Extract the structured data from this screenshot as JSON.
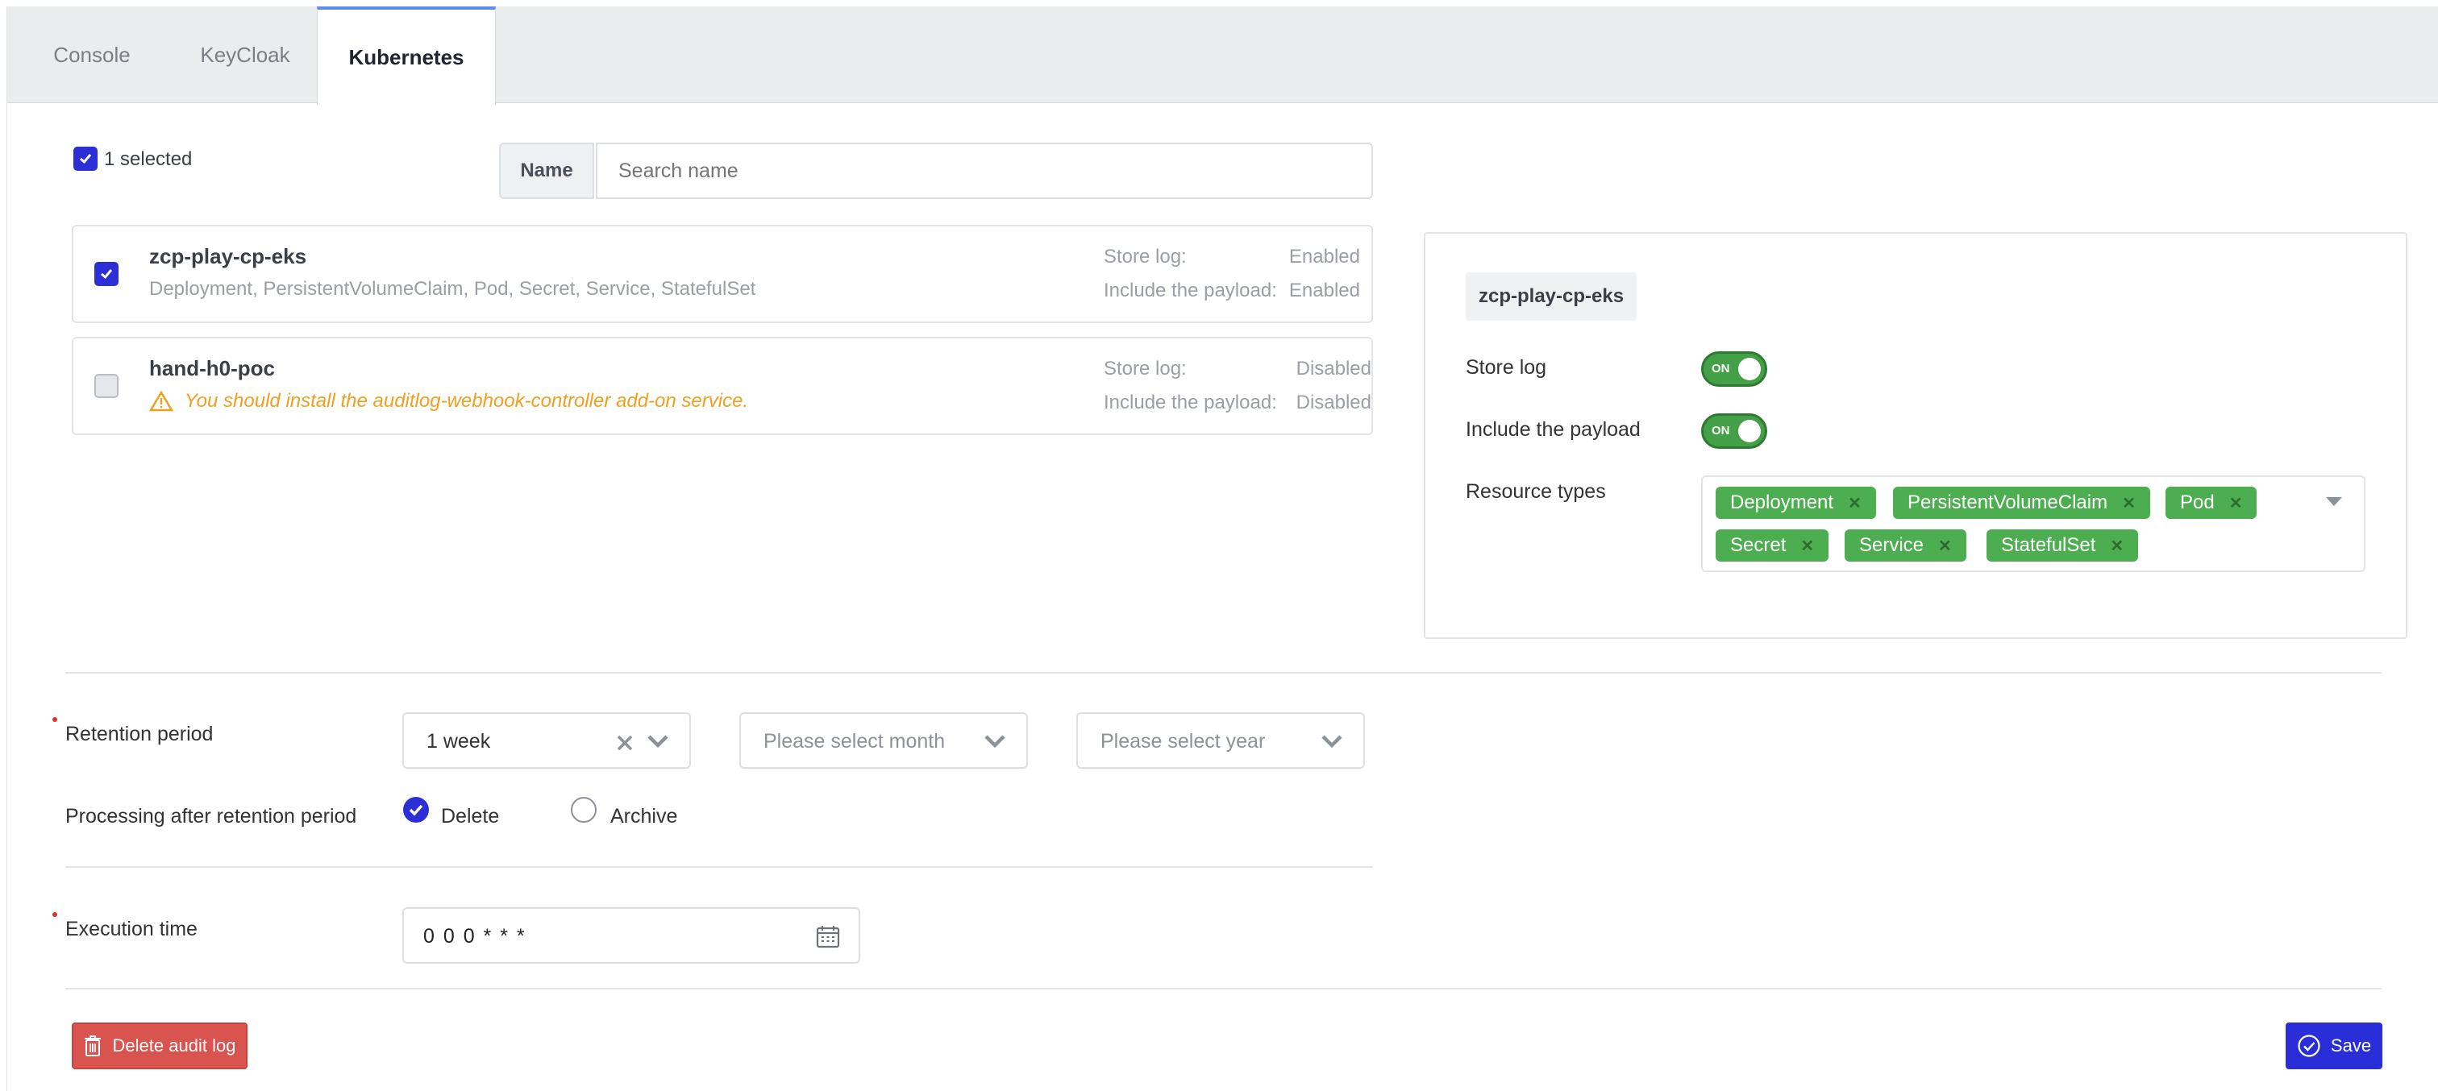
{
  "tabs": [
    {
      "label": "Console"
    },
    {
      "label": "KeyCloak"
    },
    {
      "label": "Kubernetes"
    }
  ],
  "selection": {
    "count_label": "1 selected"
  },
  "search": {
    "label": "Name",
    "placeholder": "Search name"
  },
  "clusters": [
    {
      "name": "zcp-play-cp-eks",
      "resources": "Deployment, PersistentVolumeClaim, Pod, Secret, Service, StatefulSet",
      "store_log_key": "Store log:",
      "store_log_value": "Enabled",
      "payload_key": "Include the payload:",
      "payload_value": "Enabled"
    },
    {
      "name": "hand-h0-poc",
      "warning": "You should install the auditlog-webhook-controller add-on service.",
      "store_log_key": "Store log:",
      "store_log_value": "Disabled",
      "payload_key": "Include the payload:",
      "payload_value": "Disabled"
    }
  ],
  "detail": {
    "title": "zcp-play-cp-eks",
    "store_log_label": "Store log",
    "store_log_state": "ON",
    "payload_label": "Include the payload",
    "payload_state": "ON",
    "resource_types_label": "Resource types",
    "resource_types": [
      "Deployment",
      "PersistentVolumeClaim",
      "Pod",
      "Secret",
      "Service",
      "StatefulSet"
    ]
  },
  "retention": {
    "label": "Retention period",
    "week_value": "1 week",
    "month_placeholder": "Please select month",
    "year_placeholder": "Please select year"
  },
  "processing": {
    "label": "Processing after retention period",
    "options": [
      "Delete",
      "Archive"
    ],
    "selected": "Delete"
  },
  "execution": {
    "label": "Execution time",
    "value": "0 0 0 * * *"
  },
  "actions": {
    "delete_label": "Delete audit log",
    "save_label": "Save"
  },
  "colors": {
    "primary": "#2c2fd6",
    "success": "#4cae50",
    "danger": "#d9534f",
    "warning": "#f0a020"
  }
}
